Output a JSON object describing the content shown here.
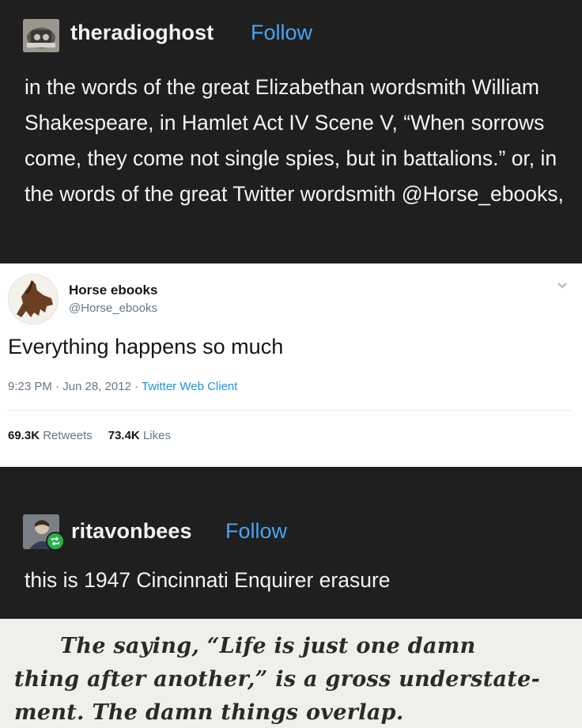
{
  "post1": {
    "username": "theradioghost",
    "follow_label": "Follow",
    "body": "in the words of the great Elizabethan wordsmith William Shakespeare, in Hamlet Act IV Scene V, “When sorrows come, they come not single spies, but in battalions.” or, in the words of the great Twitter wordsmith @Horse_ebooks,"
  },
  "tweet": {
    "name": "Horse ebooks",
    "handle": "@Horse_ebooks",
    "text": "Everything happens so much",
    "time_date": "9:23 PM · Jun 28, 2012 · ",
    "client": "Twitter Web Client",
    "retweets_count": "69.3K",
    "retweets_label": "Retweets",
    "likes_count": "73.4K",
    "likes_label": "Likes",
    "icons": {
      "menu": "chevron-down-icon",
      "avatar": "horse-avatar"
    }
  },
  "post2": {
    "username": "ritavonbees",
    "follow_label": "Follow",
    "body": "this is 1947 Cincinnati Enquirer erasure",
    "icons": {
      "badge": "reblog-icon"
    }
  },
  "clipping": {
    "line1": "The saying, “Life is just one damn",
    "line2": "thing after another,” is a gross understate-",
    "line3": "ment. The damn things overlap."
  },
  "colors": {
    "background": "#1f1f1f",
    "follow": "#4aa3f0",
    "tweet_link": "#1b95e0",
    "reblog_badge": "#27b24a"
  }
}
